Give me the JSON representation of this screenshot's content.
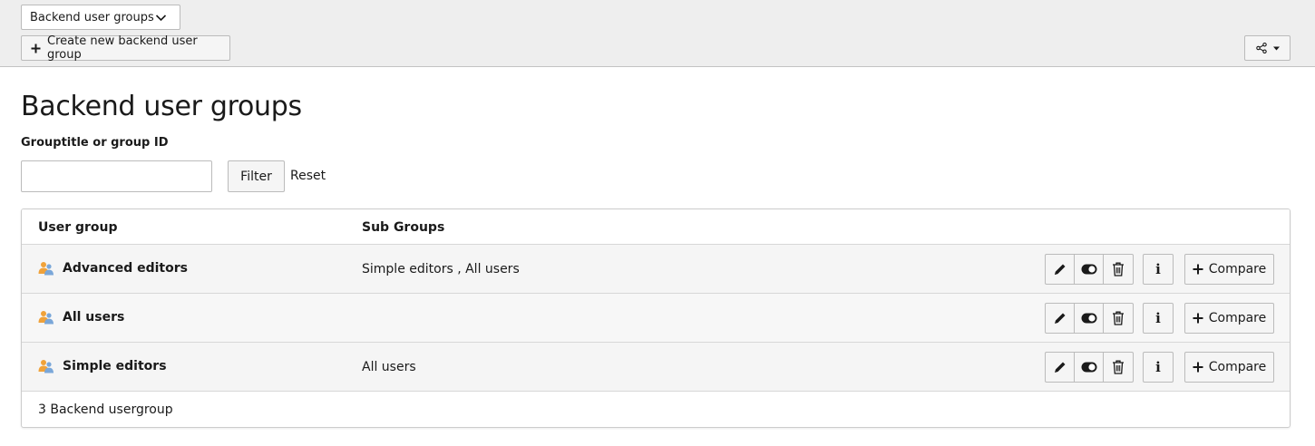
{
  "docheader": {
    "module_select": "Backend user groups",
    "create_label": "Create new backend user group"
  },
  "page": {
    "title": "Backend user groups",
    "filter_label": "Grouptitle or group ID",
    "filter_value": "",
    "filter_button": "Filter",
    "reset_link": "Reset"
  },
  "table": {
    "headers": [
      "User group",
      "Sub Groups"
    ],
    "rows": [
      {
        "name": "Advanced editors",
        "subgroups": "Simple editors , All users"
      },
      {
        "name": "All users",
        "subgroups": ""
      },
      {
        "name": "Simple editors",
        "subgroups": "All users"
      }
    ],
    "info_label": "i",
    "compare_label": "Compare",
    "footer": "3 Backend usergroup"
  },
  "icons": {
    "group": "usergroup-icon",
    "edit": "pencil-icon",
    "toggle": "toggle-icon",
    "delete": "trash-icon",
    "info": "info-icon",
    "add": "plus-icon",
    "share": "share-icon",
    "dropdown": "chevron-down-icon"
  },
  "colors": {
    "header_bg": "#eeeeee",
    "row_bg": "#f5f5f5",
    "group_icon_orange": "#f0a23a",
    "group_icon_blue": "#7aa7d9"
  }
}
